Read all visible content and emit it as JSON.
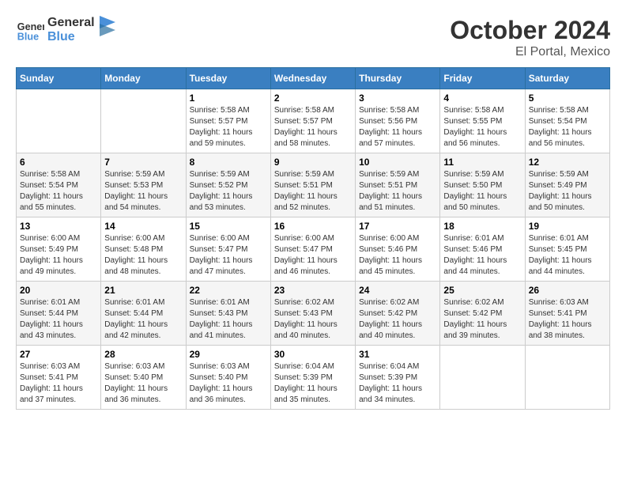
{
  "header": {
    "logo_line1": "General",
    "logo_line2": "Blue",
    "month": "October 2024",
    "location": "El Portal, Mexico"
  },
  "weekdays": [
    "Sunday",
    "Monday",
    "Tuesday",
    "Wednesday",
    "Thursday",
    "Friday",
    "Saturday"
  ],
  "weeks": [
    [
      {
        "day": "",
        "info": ""
      },
      {
        "day": "",
        "info": ""
      },
      {
        "day": "1",
        "info": "Sunrise: 5:58 AM\nSunset: 5:57 PM\nDaylight: 11 hours and 59 minutes."
      },
      {
        "day": "2",
        "info": "Sunrise: 5:58 AM\nSunset: 5:57 PM\nDaylight: 11 hours and 58 minutes."
      },
      {
        "day": "3",
        "info": "Sunrise: 5:58 AM\nSunset: 5:56 PM\nDaylight: 11 hours and 57 minutes."
      },
      {
        "day": "4",
        "info": "Sunrise: 5:58 AM\nSunset: 5:55 PM\nDaylight: 11 hours and 56 minutes."
      },
      {
        "day": "5",
        "info": "Sunrise: 5:58 AM\nSunset: 5:54 PM\nDaylight: 11 hours and 56 minutes."
      }
    ],
    [
      {
        "day": "6",
        "info": "Sunrise: 5:58 AM\nSunset: 5:54 PM\nDaylight: 11 hours and 55 minutes."
      },
      {
        "day": "7",
        "info": "Sunrise: 5:59 AM\nSunset: 5:53 PM\nDaylight: 11 hours and 54 minutes."
      },
      {
        "day": "8",
        "info": "Sunrise: 5:59 AM\nSunset: 5:52 PM\nDaylight: 11 hours and 53 minutes."
      },
      {
        "day": "9",
        "info": "Sunrise: 5:59 AM\nSunset: 5:51 PM\nDaylight: 11 hours and 52 minutes."
      },
      {
        "day": "10",
        "info": "Sunrise: 5:59 AM\nSunset: 5:51 PM\nDaylight: 11 hours and 51 minutes."
      },
      {
        "day": "11",
        "info": "Sunrise: 5:59 AM\nSunset: 5:50 PM\nDaylight: 11 hours and 50 minutes."
      },
      {
        "day": "12",
        "info": "Sunrise: 5:59 AM\nSunset: 5:49 PM\nDaylight: 11 hours and 50 minutes."
      }
    ],
    [
      {
        "day": "13",
        "info": "Sunrise: 6:00 AM\nSunset: 5:49 PM\nDaylight: 11 hours and 49 minutes."
      },
      {
        "day": "14",
        "info": "Sunrise: 6:00 AM\nSunset: 5:48 PM\nDaylight: 11 hours and 48 minutes."
      },
      {
        "day": "15",
        "info": "Sunrise: 6:00 AM\nSunset: 5:47 PM\nDaylight: 11 hours and 47 minutes."
      },
      {
        "day": "16",
        "info": "Sunrise: 6:00 AM\nSunset: 5:47 PM\nDaylight: 11 hours and 46 minutes."
      },
      {
        "day": "17",
        "info": "Sunrise: 6:00 AM\nSunset: 5:46 PM\nDaylight: 11 hours and 45 minutes."
      },
      {
        "day": "18",
        "info": "Sunrise: 6:01 AM\nSunset: 5:46 PM\nDaylight: 11 hours and 44 minutes."
      },
      {
        "day": "19",
        "info": "Sunrise: 6:01 AM\nSunset: 5:45 PM\nDaylight: 11 hours and 44 minutes."
      }
    ],
    [
      {
        "day": "20",
        "info": "Sunrise: 6:01 AM\nSunset: 5:44 PM\nDaylight: 11 hours and 43 minutes."
      },
      {
        "day": "21",
        "info": "Sunrise: 6:01 AM\nSunset: 5:44 PM\nDaylight: 11 hours and 42 minutes."
      },
      {
        "day": "22",
        "info": "Sunrise: 6:01 AM\nSunset: 5:43 PM\nDaylight: 11 hours and 41 minutes."
      },
      {
        "day": "23",
        "info": "Sunrise: 6:02 AM\nSunset: 5:43 PM\nDaylight: 11 hours and 40 minutes."
      },
      {
        "day": "24",
        "info": "Sunrise: 6:02 AM\nSunset: 5:42 PM\nDaylight: 11 hours and 40 minutes."
      },
      {
        "day": "25",
        "info": "Sunrise: 6:02 AM\nSunset: 5:42 PM\nDaylight: 11 hours and 39 minutes."
      },
      {
        "day": "26",
        "info": "Sunrise: 6:03 AM\nSunset: 5:41 PM\nDaylight: 11 hours and 38 minutes."
      }
    ],
    [
      {
        "day": "27",
        "info": "Sunrise: 6:03 AM\nSunset: 5:41 PM\nDaylight: 11 hours and 37 minutes."
      },
      {
        "day": "28",
        "info": "Sunrise: 6:03 AM\nSunset: 5:40 PM\nDaylight: 11 hours and 36 minutes."
      },
      {
        "day": "29",
        "info": "Sunrise: 6:03 AM\nSunset: 5:40 PM\nDaylight: 11 hours and 36 minutes."
      },
      {
        "day": "30",
        "info": "Sunrise: 6:04 AM\nSunset: 5:39 PM\nDaylight: 11 hours and 35 minutes."
      },
      {
        "day": "31",
        "info": "Sunrise: 6:04 AM\nSunset: 5:39 PM\nDaylight: 11 hours and 34 minutes."
      },
      {
        "day": "",
        "info": ""
      },
      {
        "day": "",
        "info": ""
      }
    ]
  ]
}
